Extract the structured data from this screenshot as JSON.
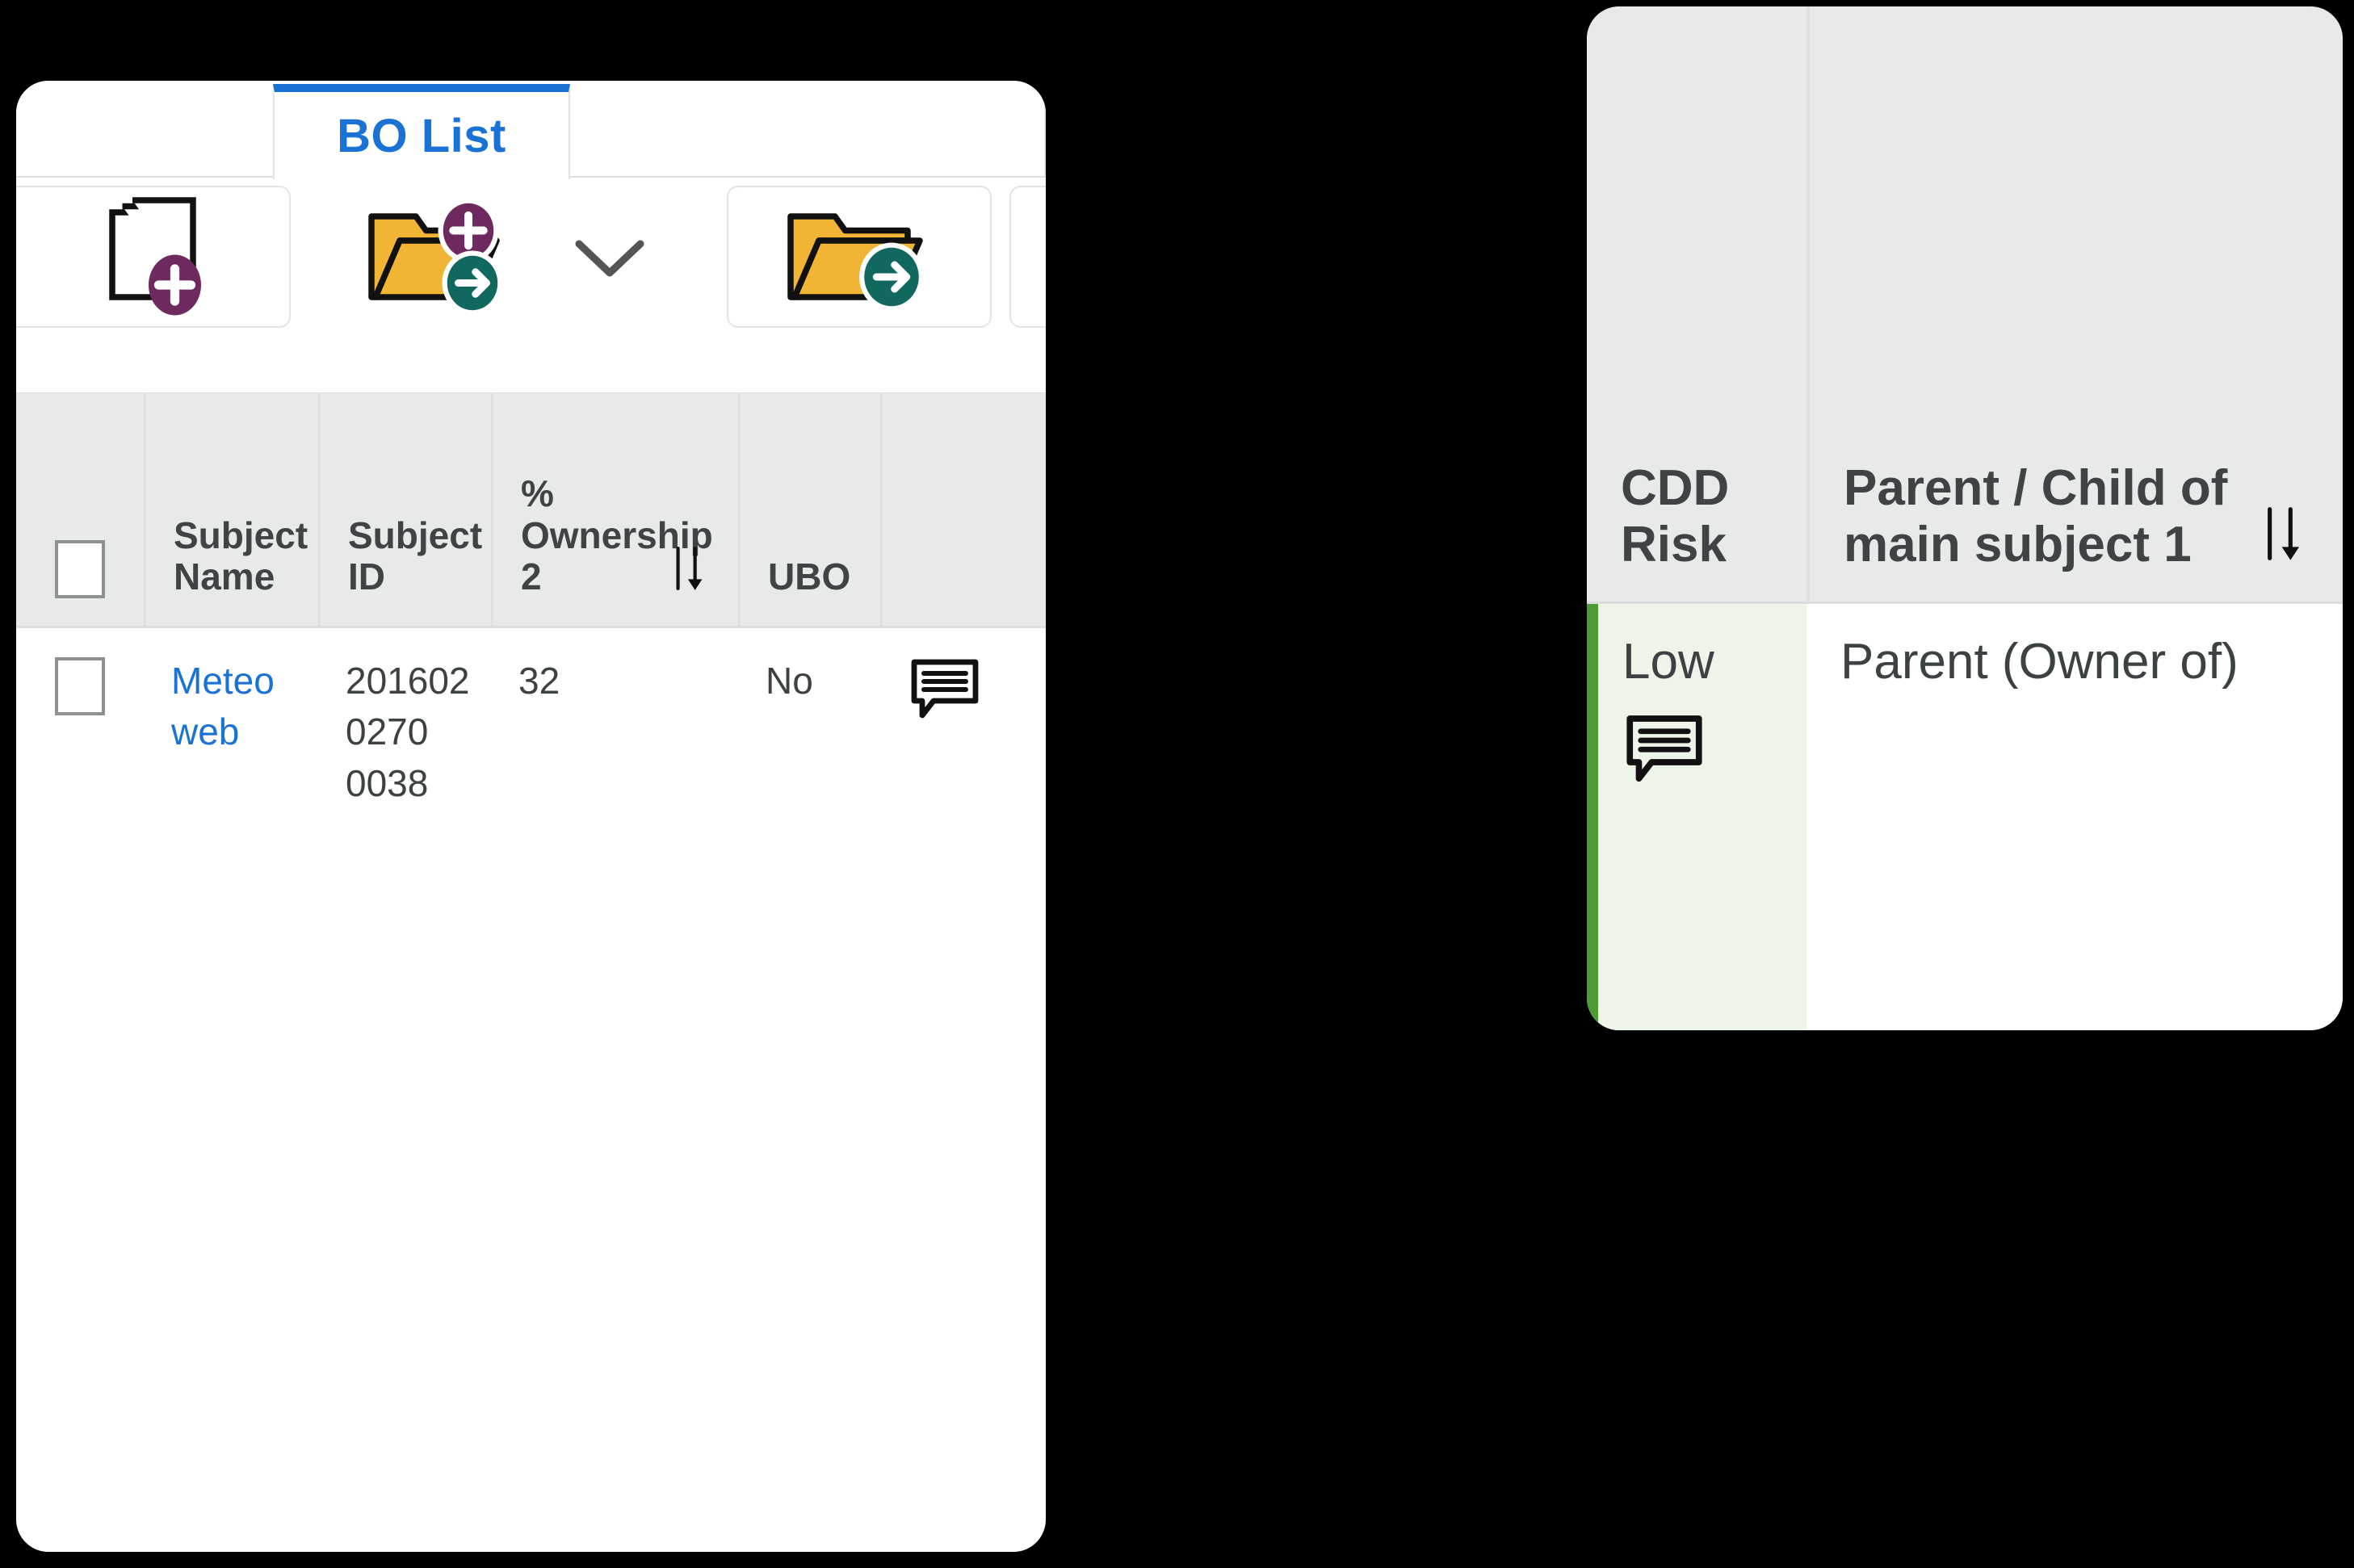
{
  "tabs": [
    {
      "label": "BO List",
      "active": true
    }
  ],
  "toolbar": {
    "buttons": [
      {
        "name": "add-document-button",
        "icon": "document-add-icon",
        "boxed": true
      },
      {
        "name": "add-folder-move-button",
        "icon": "folder-add-arrow-icon",
        "boxed": false
      },
      {
        "name": "toolbar-more-button",
        "icon": "chevron-down-icon",
        "boxed": false
      },
      {
        "name": "open-folder-move-button",
        "icon": "folder-arrow-icon",
        "boxed": true
      },
      {
        "name": "search-folder-move-button",
        "icon": "folder-search-arrow-icon",
        "boxed": true
      },
      {
        "name": "add-flag-move-button",
        "icon": "flag-add-arrow-icon",
        "boxed": false
      }
    ]
  },
  "table": {
    "select_all_label": "",
    "columns": [
      {
        "key": "checkbox",
        "label": "",
        "sortable": false
      },
      {
        "key": "name",
        "label": "Subject Name",
        "sortable": false
      },
      {
        "key": "id",
        "label": "Subject ID",
        "sortable": false
      },
      {
        "key": "own",
        "label": "% Ownership 2",
        "sortable": true,
        "sort_dir": "desc"
      },
      {
        "key": "ubo",
        "label": "UBO",
        "sortable": false
      },
      {
        "key": "comment",
        "label": "",
        "sortable": false
      }
    ],
    "rows": [
      {
        "checked": false,
        "name": "Meteo web",
        "id": "2016020270 0038",
        "own": "32",
        "ubo": "No",
        "comment_icon": "comment-icon"
      }
    ]
  },
  "overlay": {
    "columns": [
      {
        "key": "cdd_risk",
        "label": "CDD Risk",
        "sortable": false
      },
      {
        "key": "relation",
        "label": "Parent / Child of main subject 1",
        "sortable": true,
        "sort_dir": "desc"
      }
    ],
    "rows": [
      {
        "cdd_risk": "Low",
        "cdd_risk_color": "#4d9b34",
        "cdd_risk_bg": "#edf4e8",
        "cdd_comment_icon": "comment-icon",
        "relation": "Parent (Owner of)"
      }
    ]
  },
  "colors": {
    "accent_blue": "#1a73d4",
    "header_gray": "#e8eaea",
    "risk_low_green": "#4d9b34",
    "risk_low_bg": "#edf4e8",
    "folder_yellow": "#f2b434",
    "badge_purple": "#6e2a5e",
    "badge_teal": "#10685f",
    "badge_navy": "#2c2a6b",
    "flag_red": "#e8253a"
  }
}
